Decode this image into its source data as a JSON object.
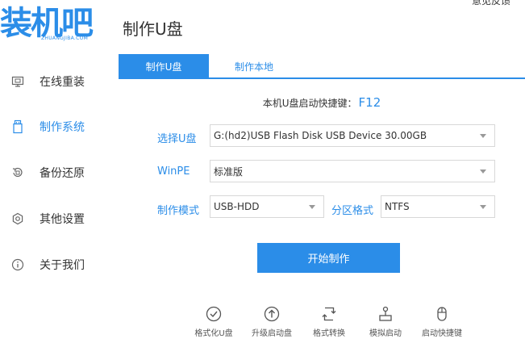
{
  "app": {
    "logo_text": "装机吧",
    "logo_sub": "ZHUANGJIBA.COM",
    "top_link": "意见反馈"
  },
  "sidebar": {
    "items": [
      {
        "label": "在线重装",
        "icon": "monitor-icon",
        "active": false
      },
      {
        "label": "制作系统",
        "icon": "usb-drive-icon",
        "active": true
      },
      {
        "label": "备份还原",
        "icon": "backup-icon",
        "active": false
      },
      {
        "label": "其他设置",
        "icon": "gear-icon",
        "active": false
      },
      {
        "label": "关于我们",
        "icon": "info-icon",
        "active": false
      }
    ]
  },
  "main": {
    "title": "制作U盘",
    "tabs": [
      {
        "label": "制作U盘",
        "active": true
      },
      {
        "label": "制作本地",
        "active": false
      }
    ],
    "hotkey_label": "本机U盘启动快捷键：",
    "hotkey_value": "F12",
    "form": {
      "usb_label": "选择U盘",
      "usb_value": "G:(hd2)USB Flash Disk USB Device 30.00GB",
      "winpe_label": "WinPE",
      "winpe_value": "标准版",
      "mode_label": "制作模式",
      "mode_value": "USB-HDD",
      "partition_label": "分区格式",
      "partition_value": "NTFS"
    },
    "start_button": "开始制作",
    "tools": [
      {
        "label": "格式化U盘",
        "icon": "check-circle-icon"
      },
      {
        "label": "升级启动盘",
        "icon": "upload-circle-icon"
      },
      {
        "label": "格式转换",
        "icon": "convert-icon"
      },
      {
        "label": "模拟启动",
        "icon": "joystick-icon"
      },
      {
        "label": "启动快捷键",
        "icon": "mouse-icon"
      }
    ]
  },
  "colors": {
    "accent": "#2b8de8",
    "text": "#333333",
    "border": "#d8d8d8"
  }
}
